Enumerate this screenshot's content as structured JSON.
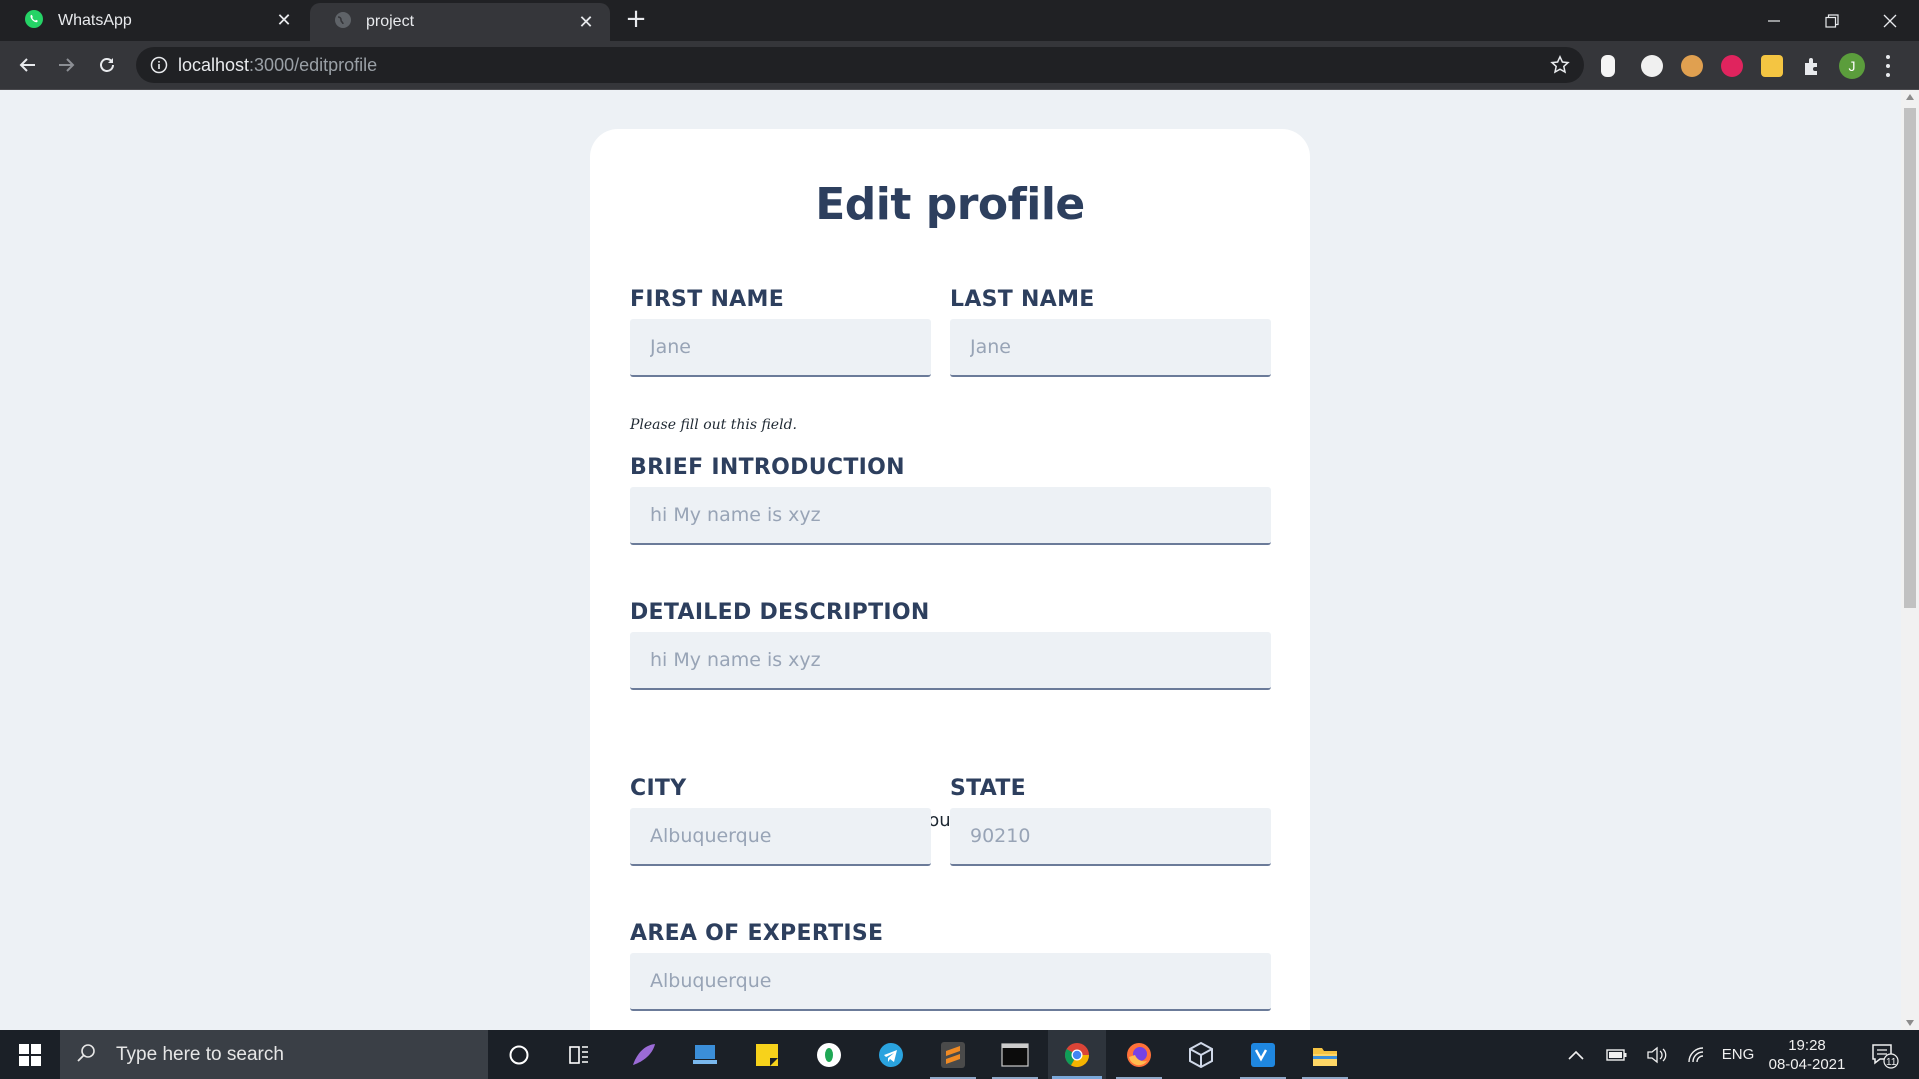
{
  "browser": {
    "tabs": [
      {
        "title": "WhatsApp",
        "active": false
      },
      {
        "title": "project",
        "active": true
      }
    ],
    "url_host": "localhost",
    "url_path": ":3000/editprofile",
    "profile_initial": "J"
  },
  "form": {
    "title": "Edit profile",
    "first_name": {
      "label": "FIRST NAME",
      "placeholder": "Jane",
      "validation": "Please fill out this field."
    },
    "last_name": {
      "label": "LAST NAME",
      "placeholder": "Jane"
    },
    "brief_intro": {
      "label": "BRIEF INTRODUCTION",
      "placeholder": "hi My name is xyz"
    },
    "detailed_desc": {
      "label": "DETAILED DESCRIPTION",
      "placeholder": "hi My name is xyz",
      "hint": "Make it as long and as crazy as you'd like"
    },
    "city": {
      "label": "CITY",
      "placeholder": "Albuquerque"
    },
    "state": {
      "label": "STATE",
      "placeholder": "90210"
    },
    "expertise": {
      "label": "AREA OF EXPERTISE",
      "placeholder": "Albuquerque"
    }
  },
  "taskbar": {
    "search_placeholder": "Type here to search",
    "language": "ENG",
    "time": "19:28",
    "date": "08-04-2021",
    "notification_count": "11"
  },
  "colors": {
    "heading": "#2d3f5e",
    "page_bg": "#edf1f5",
    "card_bg": "#ffffff",
    "field_bg": "#edf1f5"
  }
}
